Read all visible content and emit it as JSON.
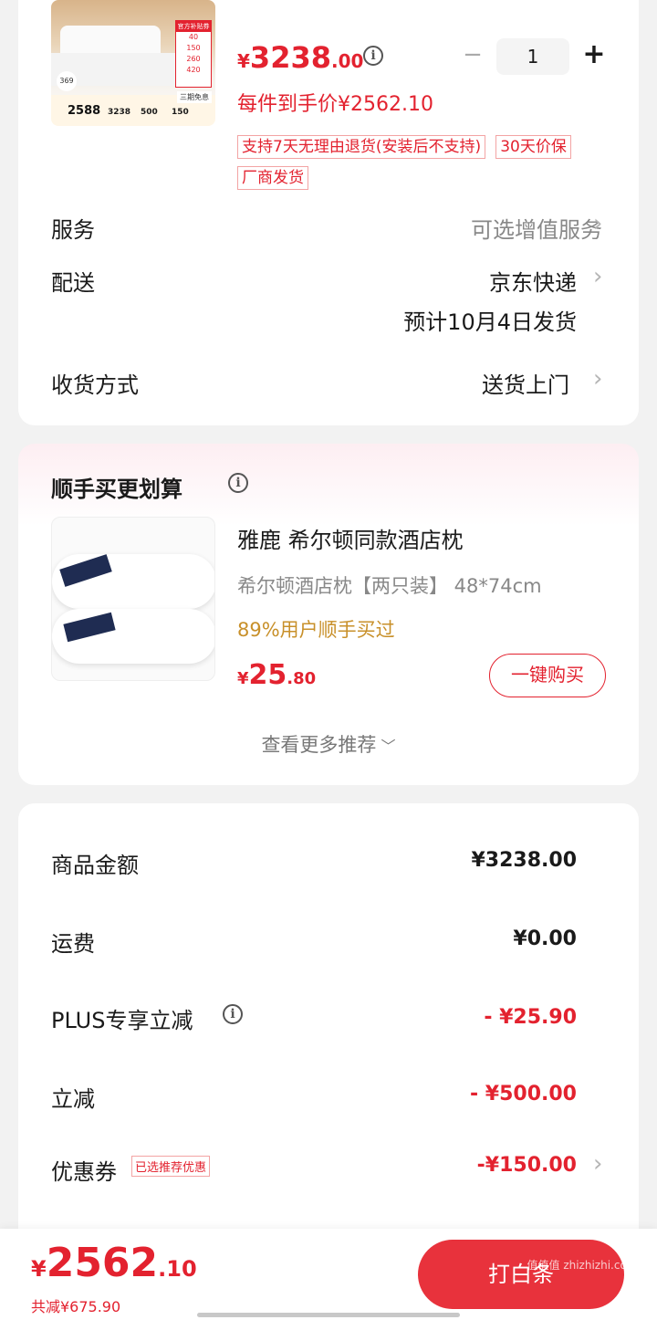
{
  "product": {
    "price_int": "3238",
    "price_dec": ".00",
    "currency": "¥",
    "quantity": "1",
    "final_price_text": "每件到手价¥2562.10",
    "tags": [
      "支持7天无理由退货(安装后不支持)",
      "30天价保",
      "厂商发货"
    ],
    "thumb": {
      "badge_top": "官方补贴券",
      "deals": [
        "40",
        "150",
        "260",
        "420"
      ],
      "price_main": "2588",
      "price_row": [
        "3238",
        "500",
        "150"
      ],
      "promo": "三期免息",
      "corner": "369"
    }
  },
  "rows": {
    "service_label": "服务",
    "service_value": "可选增值服务",
    "delivery_label": "配送",
    "delivery_value": "京东快递",
    "delivery_eta": "预计10月4日发货",
    "receive_label": "收货方式",
    "receive_value": "送货上门"
  },
  "recommend": {
    "title": "顺手买更划算",
    "item_title": "雅鹿 希尔顿同款酒店枕",
    "item_sub": "希尔顿酒店枕【两只装】 48*74cm",
    "item_stat": "89%用户顺手买过",
    "currency": "¥",
    "price_int": "25",
    "price_dec": ".80",
    "buy_label": "一键购买",
    "more_label": "查看更多推荐"
  },
  "summary": {
    "goods_label": "商品金额",
    "goods_value": "¥3238.00",
    "ship_label": "运费",
    "ship_value": "¥0.00",
    "plus_label": "PLUS专享立减",
    "plus_value": "- ¥25.90",
    "discount_label": "立减",
    "discount_value": "- ¥500.00",
    "coupon_label": "优惠券",
    "coupon_tag": "已选推荐优惠",
    "coupon_value": "-¥150.00"
  },
  "footer": {
    "currency": "¥",
    "total_int": "2562",
    "total_dec": ".10",
    "saved": "共减¥675.90",
    "submit_label": "打白条",
    "watermark": "值值值 zhizhizhi.com"
  },
  "colors": {
    "accent": "#e3222f",
    "gold": "#c8902a",
    "bg": "#f2f2f2"
  }
}
